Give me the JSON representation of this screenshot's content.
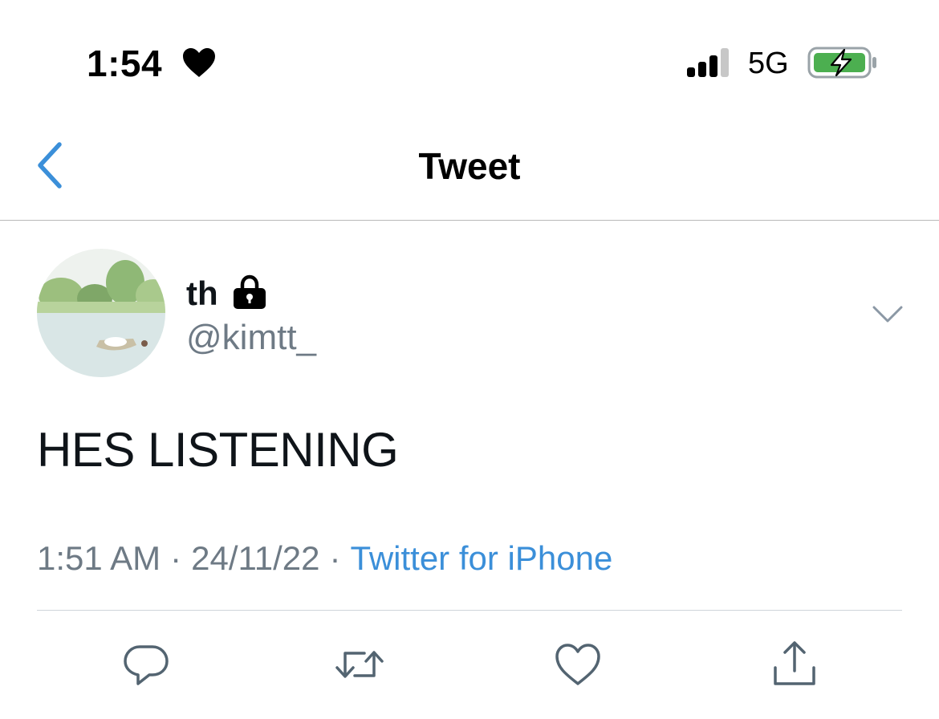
{
  "status_bar": {
    "time": "1:54",
    "network": "5G",
    "icons": [
      "heart-icon",
      "signal-icon",
      "battery-charging-icon"
    ]
  },
  "nav": {
    "title": "Tweet",
    "back_icon": "chevron-left-icon"
  },
  "tweet": {
    "display_name": "th",
    "username": "@kimtt_",
    "text": "HES LISTENING",
    "time": "1:51 AM",
    "date": "24/11/22",
    "separator": "·",
    "source": "Twitter for iPhone",
    "protected_icon": "lock-icon",
    "menu_icon": "chevron-down-icon"
  },
  "actions": [
    {
      "icon": "reply-icon"
    },
    {
      "icon": "retweet-icon"
    },
    {
      "icon": "like-icon"
    },
    {
      "icon": "share-icon"
    }
  ],
  "colors": {
    "accent": "#3b8fd9",
    "muted": "#6e7a85",
    "battery": "#4caf50"
  }
}
